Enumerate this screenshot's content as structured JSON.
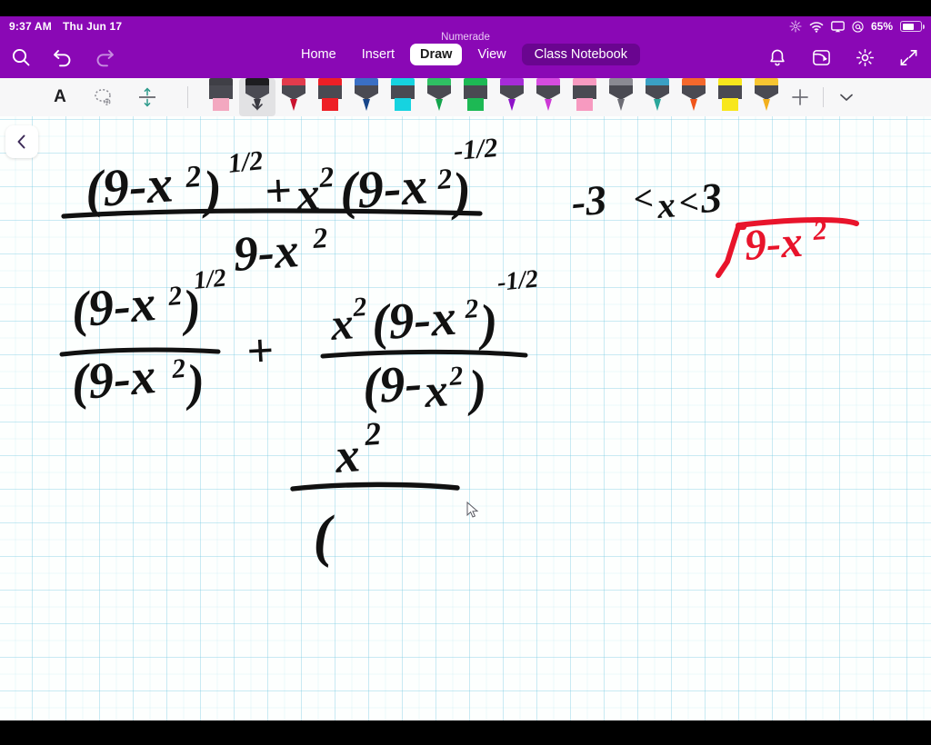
{
  "status_bar": {
    "time": "9:37 AM",
    "date": "Thu Jun 17",
    "battery_percent": "65%",
    "icons": [
      "brightness-sparkle-icon",
      "wifi-icon",
      "airplay-icon",
      "at-symbol-icon",
      "battery-icon"
    ]
  },
  "ribbon": {
    "app_title": "Numerade",
    "left_icons": [
      {
        "name": "search-icon"
      },
      {
        "name": "undo-icon"
      },
      {
        "name": "redo-icon"
      }
    ],
    "tabs": [
      {
        "label": "Home",
        "active": false,
        "style": "plain"
      },
      {
        "label": "Insert",
        "active": false,
        "style": "plain"
      },
      {
        "label": "Draw",
        "active": true,
        "style": "active"
      },
      {
        "label": "View",
        "active": false,
        "style": "plain"
      },
      {
        "label": "Class Notebook",
        "active": false,
        "style": "notebook"
      }
    ],
    "right_icons": [
      {
        "name": "bell-icon"
      },
      {
        "name": "share-icon"
      },
      {
        "name": "settings-gear-icon"
      },
      {
        "name": "collapse-ribbon-icon"
      }
    ]
  },
  "pen_toolbar": {
    "tools": [
      {
        "name": "text-tool",
        "label": "A"
      },
      {
        "name": "lasso-select-tool"
      },
      {
        "name": "insert-space-tool"
      }
    ],
    "pens": [
      {
        "name": "pen-pink-highlighter",
        "color": "#f3a8c0",
        "top": "#3f3f46",
        "type": "highlighter",
        "selected": false
      },
      {
        "name": "pen-black",
        "color": "#3a3a42",
        "top": "#1d1d20",
        "type": "pen",
        "selected": true
      },
      {
        "name": "pen-red-dark",
        "color": "#c9122f",
        "top": "#e23b4c",
        "type": "pen",
        "selected": false
      },
      {
        "name": "pen-red-highlighter",
        "color": "#ee1f26",
        "top": "#ee1f26",
        "type": "highlighter",
        "selected": false
      },
      {
        "name": "pen-blue",
        "color": "#17468a",
        "top": "#3a6fc4",
        "type": "pen",
        "selected": false
      },
      {
        "name": "pen-cyan-highlighter",
        "color": "#16d3e0",
        "top": "#16d3e0",
        "type": "highlighter",
        "selected": false
      },
      {
        "name": "pen-green",
        "color": "#13a44c",
        "top": "#2fbf63",
        "type": "pen",
        "selected": false
      },
      {
        "name": "pen-green-highlighter",
        "color": "#1db954",
        "top": "#1db954",
        "type": "highlighter",
        "selected": false
      },
      {
        "name": "pen-purple",
        "color": "#8e12c9",
        "top": "#a62bd8",
        "type": "pen",
        "selected": false
      },
      {
        "name": "pen-magenta",
        "color": "#cd38d6",
        "top": "#d64ce0",
        "type": "pen",
        "selected": false
      },
      {
        "name": "pen-pink-highlighter-2",
        "color": "#f79ac0",
        "top": "#f79ac0",
        "type": "highlighter",
        "selected": false
      },
      {
        "name": "pen-gray",
        "color": "#6d6d75",
        "top": "#8a8a92",
        "type": "pen",
        "selected": false
      },
      {
        "name": "pen-teal",
        "color": "#2aa79b",
        "top": "#3aa0c4",
        "type": "pen",
        "selected": false
      },
      {
        "name": "pen-orange",
        "color": "#f0551b",
        "top": "#f4682c",
        "type": "pen",
        "selected": false
      },
      {
        "name": "pen-yellow-highlighter",
        "color": "#f8e71c",
        "top": "#f8e71c",
        "type": "highlighter",
        "selected": false
      },
      {
        "name": "pen-gold",
        "color": "#f2b01e",
        "top": "#f7c531",
        "type": "pen",
        "selected": false
      }
    ],
    "add_pen_label": "+",
    "expand_icon": "chevron-down-icon"
  },
  "canvas": {
    "back_button_icon": "chevron-left-icon",
    "ink_color_primary": "#111111",
    "ink_color_accent": "#e8142b",
    "handwritten_content": [
      {
        "name": "expression-line-1",
        "text": "((9-x^2)^(1/2) + x^2 (9-x^2)^(-1/2)) / (9 - x^2)",
        "color": "#111111"
      },
      {
        "name": "domain-note",
        "text": "-3 < x < 3",
        "color": "#111111"
      },
      {
        "name": "radical-note",
        "text": "sqrt(9 - x^2)",
        "color": "#e8142b"
      },
      {
        "name": "expression-line-2-left",
        "text": "(9-x^2)^(1/2) / (9-x^2)",
        "color": "#111111"
      },
      {
        "name": "expression-plus-sign",
        "text": "+",
        "color": "#111111"
      },
      {
        "name": "expression-line-2-right",
        "text": "x^2 (9-x^2)^(-1/2) / (9-x^2)",
        "color": "#111111"
      },
      {
        "name": "expression-line-3",
        "text": "x^2 / (",
        "color": "#111111"
      }
    ]
  }
}
